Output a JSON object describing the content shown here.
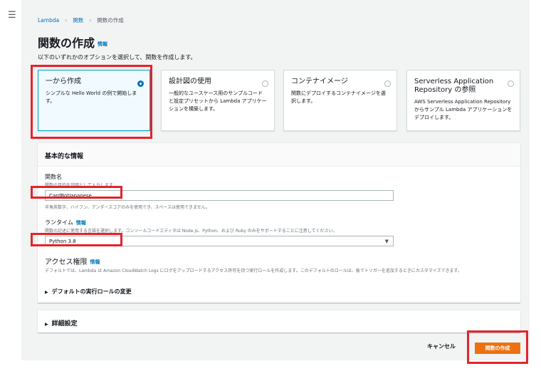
{
  "nav": {
    "menu_icon": "hamburger-menu-icon"
  },
  "breadcrumb": {
    "items": [
      "Lambda",
      "関数",
      "関数の作成"
    ]
  },
  "header": {
    "title": "関数の作成",
    "info": "情報",
    "subtitle": "以下のいずれかのオプションを選択して、関数を作成します。"
  },
  "options": [
    {
      "title": "一から作成",
      "desc": "シンプルな Hello World の例で開始します。",
      "selected": true
    },
    {
      "title": "設計図の使用",
      "desc": "一般的なユースケース用のサンプルコードと設定プリセットから Lambda アプリケーションを構築します。",
      "selected": false
    },
    {
      "title": "コンテナイメージ",
      "desc": "関数にデプロイするコンテナイメージを選択します。",
      "selected": false
    },
    {
      "title": "Serverless Application Repository の参照",
      "desc": "AWS Serverless Application Repository からサンプル Lambda アプリケーションをデプロイします。",
      "selected": false
    }
  ],
  "basic": {
    "header": "基本的な情報",
    "function_name": {
      "label": "関数名",
      "hint": "関数の目的を説明として入力します",
      "value": "CardBotJapanese",
      "constraint": "半角英数字、ハイフン、アンダースコアのみを使用でき、スペースは使用できません。"
    },
    "runtime": {
      "label": "ランタイム",
      "info": "情報",
      "hint": "関数の記述に使用する言語を選択します。コンソールコードエディタは Node.js、Python、および Ruby のみをサポートすることに注意してください。",
      "value": "Python 3.8"
    },
    "access": {
      "title": "アクセス権限",
      "info": "情報",
      "desc": "デフォルトでは、Lambda は Amazon CloudWatch Logs にログをアップロードするアクセス許可を持つ実行ロールを作成します。このデフォルトのロールは、後でトリガーを追加するときにカスタマイズできます。",
      "expander": "デフォルトの実行ロールの変更"
    }
  },
  "advanced": {
    "label": "詳細設定"
  },
  "footer": {
    "cancel": "キャンセル",
    "create": "関数の作成"
  },
  "colors": {
    "accent": "#ec7211",
    "link": "#0073bb",
    "highlight": "#e3242b"
  }
}
